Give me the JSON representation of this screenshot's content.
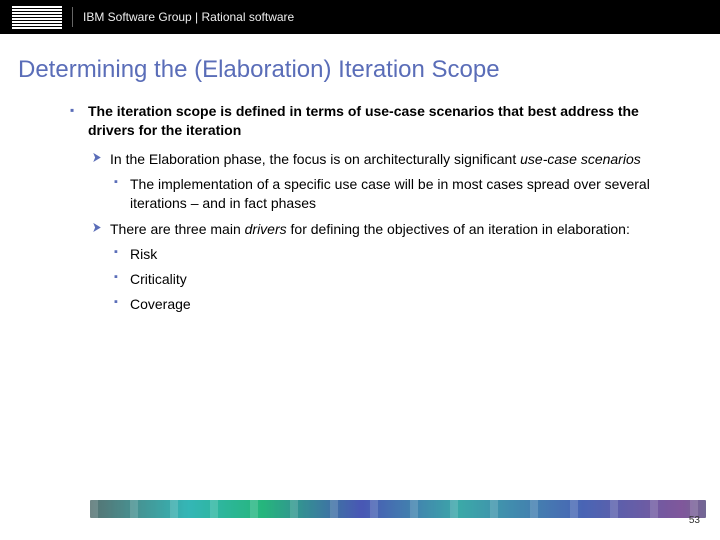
{
  "header": {
    "logo_name": "ibm-logo",
    "text": "IBM Software Group | Rational software"
  },
  "title": "Determining the (Elaboration) Iteration Scope",
  "bullets": {
    "main": "The iteration scope is defined in terms of use-case scenarios that best address the drivers for the iteration",
    "sub1_a": "In the Elaboration phase, the focus is on architecturally significant ",
    "sub1_b_ital": "use-case scenarios",
    "sub1_child": "The implementation of a specific use case will be in most cases spread over several iterations – and in fact phases",
    "sub2_a": "There are three main ",
    "sub2_b_ital": "drivers",
    "sub2_c": " for defining the objectives of an iteration in elaboration:",
    "drivers": {
      "risk": "Risk",
      "criticality": "Criticality",
      "coverage": "Coverage"
    }
  },
  "page_number": "53"
}
